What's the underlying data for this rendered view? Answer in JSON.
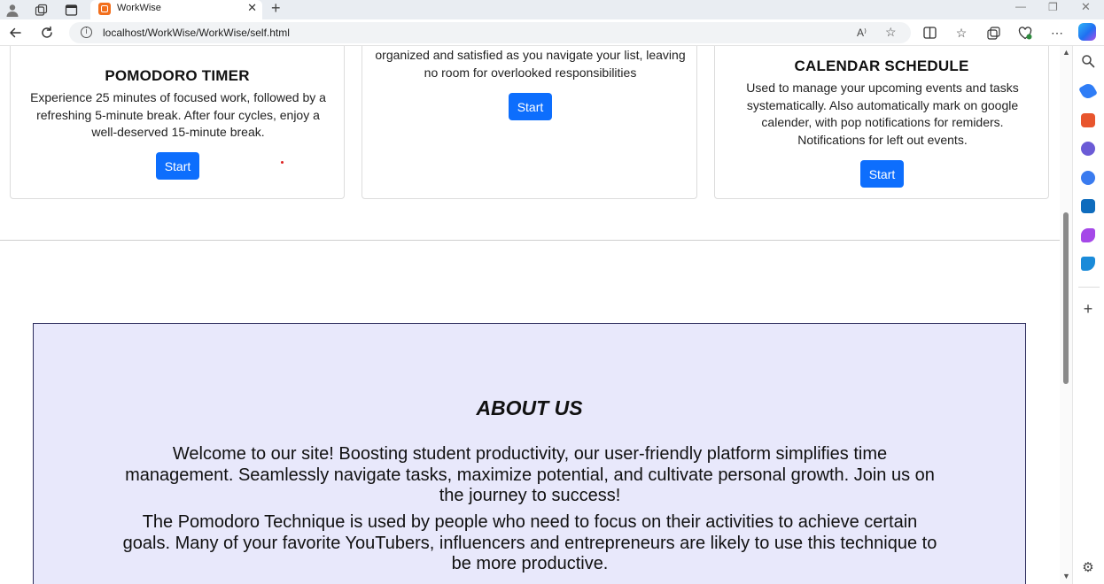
{
  "browser": {
    "tab_title": "WorkWise",
    "tab_close": "✕",
    "new_tab": "+",
    "url": "localhost/WorkWise/WorkWise/self.html",
    "read_aloud_label": "A⁾"
  },
  "cards": [
    {
      "title": "POMODORO TIMER",
      "description": "Experience 25 minutes of focused work, followed by a refreshing 5-minute break. After four cycles, enjoy a well-deserved 15-minute break.",
      "button": "Start"
    },
    {
      "title": "",
      "description": "organized and satisfied as you navigate your list, leaving no room for overlooked responsibilities",
      "button": "Start"
    },
    {
      "title": "CALENDAR SCHEDULE",
      "description": "Used to manage your upcoming events and tasks systematically. Also automatically mark on google calender, with pop notifications for remiders. Notifications for left out events.",
      "button": "Start"
    }
  ],
  "about": {
    "heading": "ABOUT US",
    "paragraph1": "Welcome to our site! Boosting student productivity, our user-friendly platform simplifies time management. Seamlessly navigate tasks, maximize potential, and cultivate personal growth. Join us on the journey to success!",
    "paragraph2": "The Pomodoro Technique is used by people who need to focus on their activities to achieve certain goals. Many of your favorite YouTubers, influencers and entrepreneurs are likely to use this technique to be more productive."
  },
  "colors": {
    "primary_button": "#0d6efd",
    "about_background": "#e8e8fb",
    "about_border": "#2c2c5c"
  }
}
